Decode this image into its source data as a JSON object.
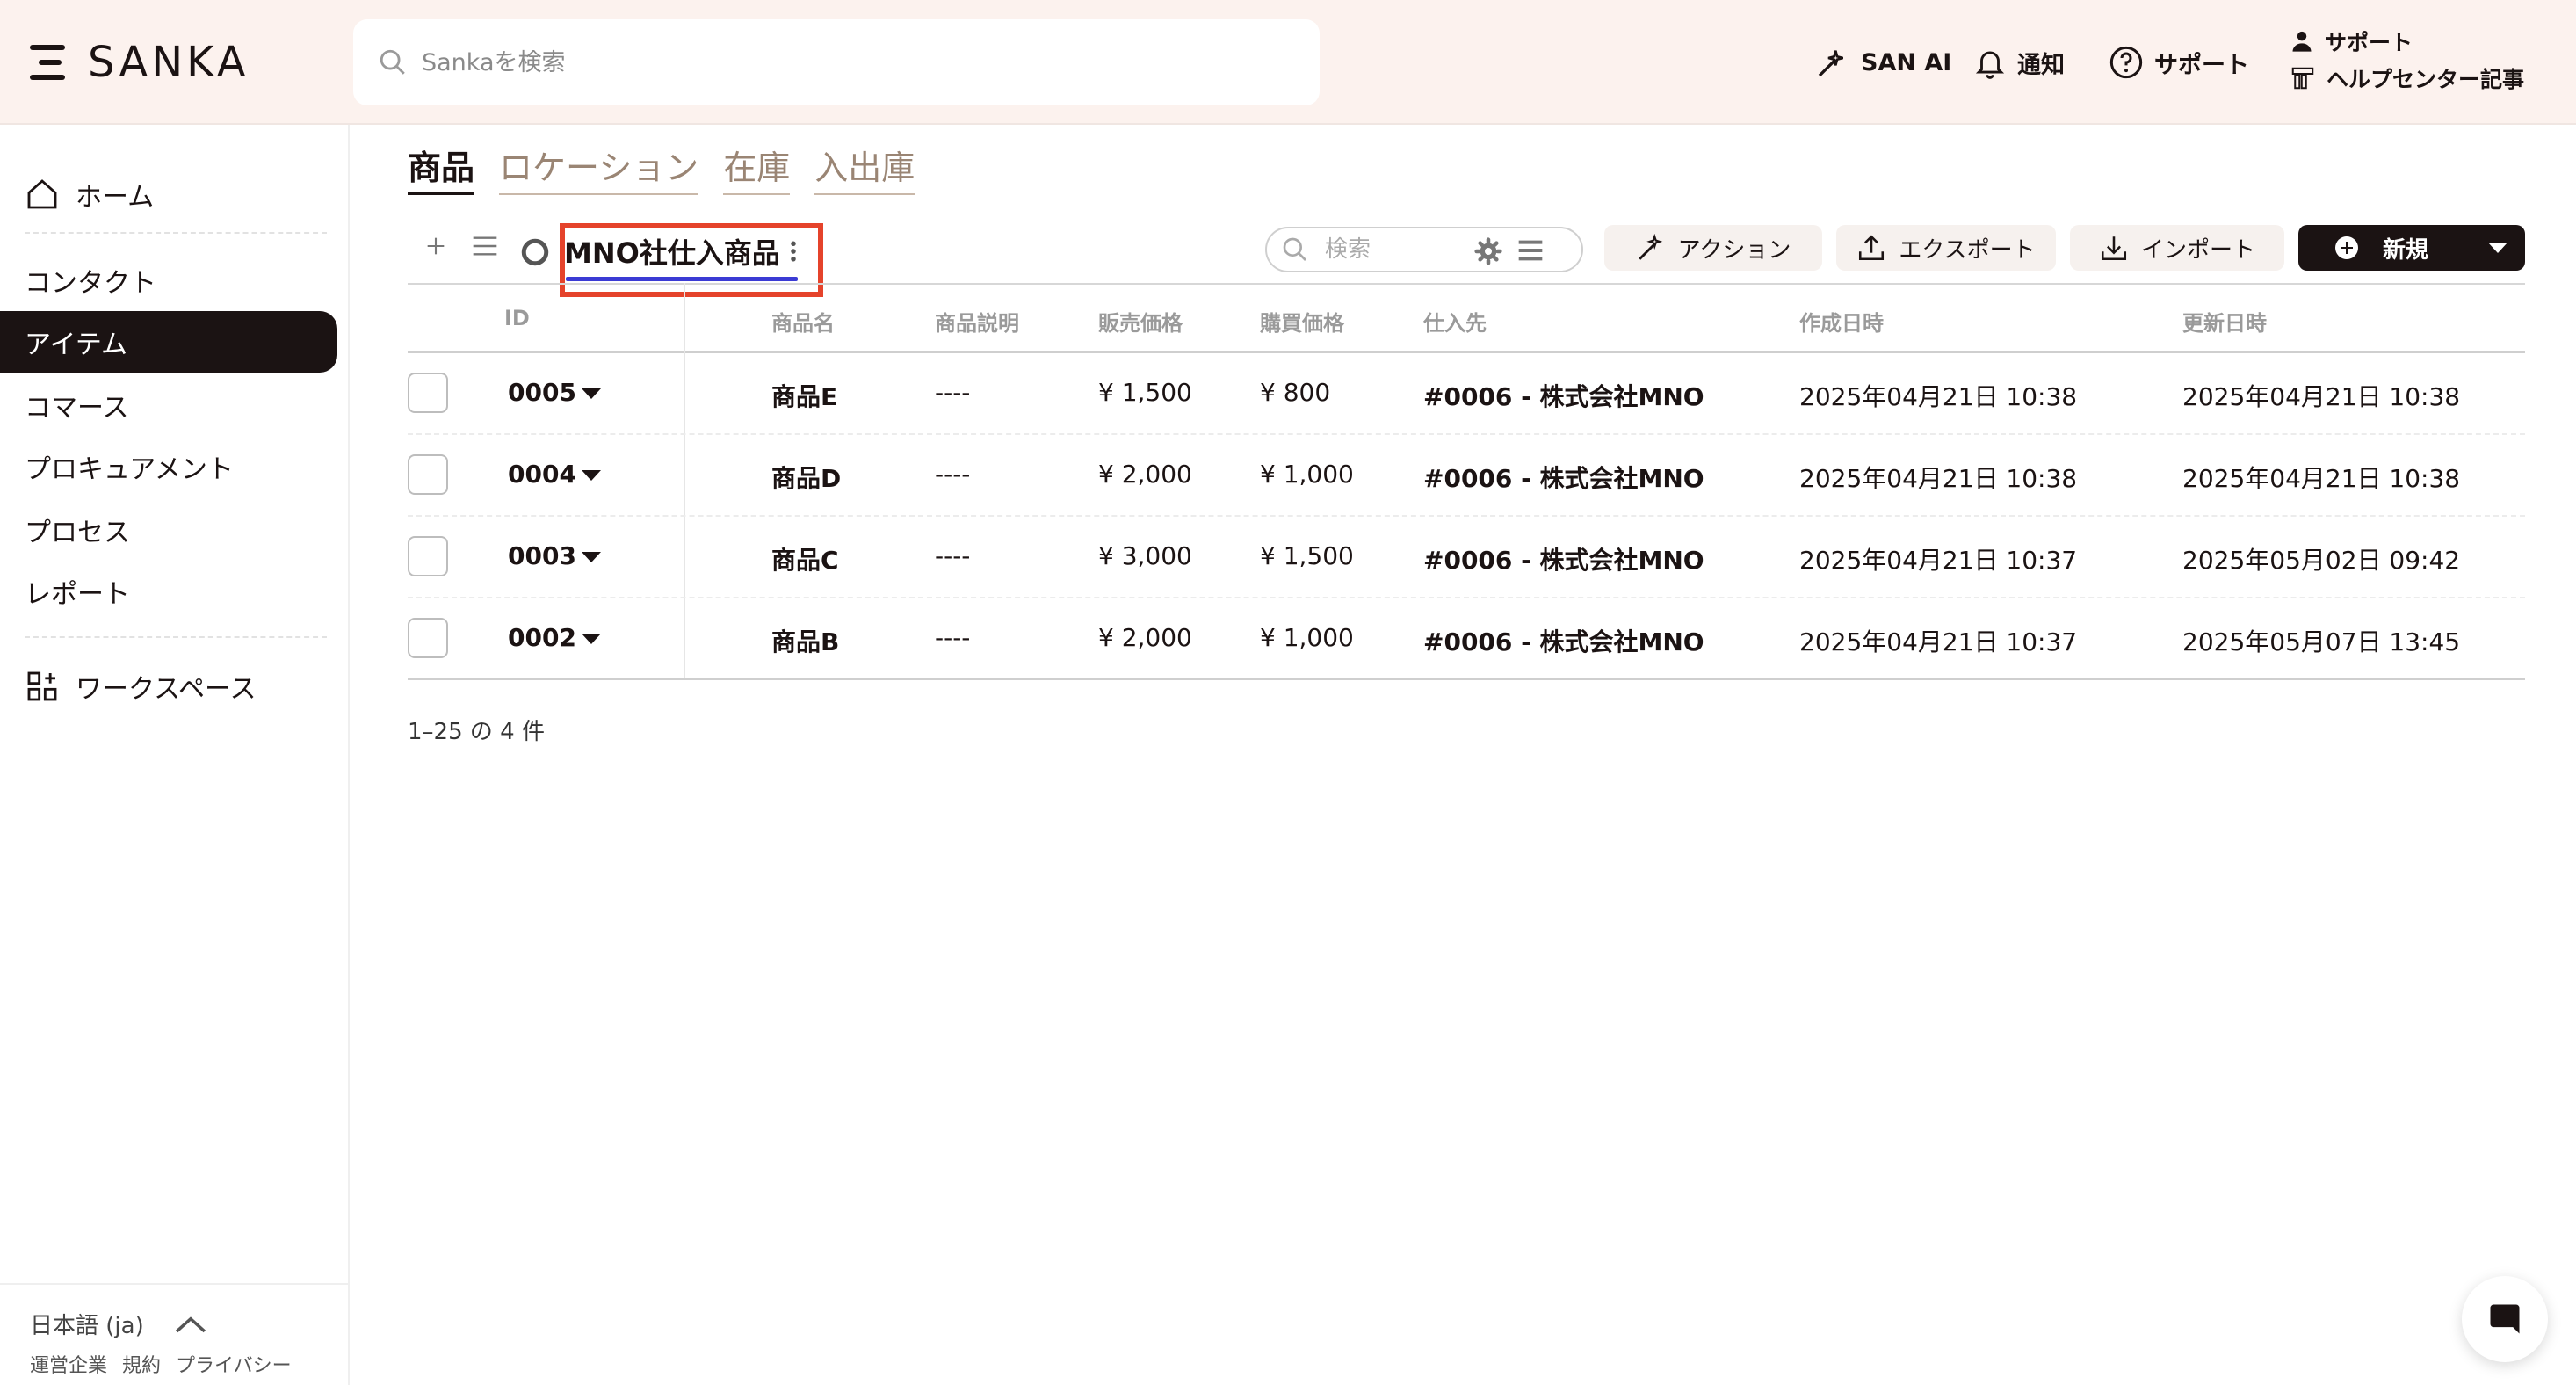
{
  "header": {
    "logo_text": "SANKA",
    "search_placeholder": "Sankaを検索",
    "san_ai": "SAN AI",
    "notifications": "通知",
    "support": "サポート",
    "support_stack": {
      "top": "サポート",
      "bottom": "ヘルプセンター記事"
    }
  },
  "sidebar": {
    "items": [
      {
        "label": "ホーム",
        "icon": "home-icon"
      },
      {
        "label": "コンタクト"
      },
      {
        "label": "アイテム",
        "active": true
      },
      {
        "label": "コマース"
      },
      {
        "label": "プロキュアメント"
      },
      {
        "label": "プロセス"
      },
      {
        "label": "レポート"
      },
      {
        "label": "ワークスペース",
        "icon": "workspace-icon"
      }
    ],
    "language": "日本語 (ja)",
    "legal": [
      "運営企業",
      "規約",
      "プライバシー"
    ]
  },
  "main": {
    "tabs": [
      {
        "label": "商品",
        "active": true
      },
      {
        "label": "ロケーション"
      },
      {
        "label": "在庫"
      },
      {
        "label": "入出庫"
      }
    ],
    "view_tab": "MNO社仕入商品",
    "toolbar": {
      "search_placeholder": "検索",
      "action": "アクション",
      "export": "エクスポート",
      "import": "インポート",
      "new": "新規"
    },
    "table": {
      "columns": [
        "ID",
        "商品名",
        "商品説明",
        "販売価格",
        "購買価格",
        "仕入先",
        "作成日時",
        "更新日時"
      ],
      "rows": [
        {
          "id": "0005",
          "name": "商品E",
          "desc": "----",
          "sale": "¥ 1,500",
          "purchase": "¥ 800",
          "supplier": "#0006 - 株式会社MNO",
          "created": "2025年04月21日 10:38",
          "updated": "2025年04月21日 10:38"
        },
        {
          "id": "0004",
          "name": "商品D",
          "desc": "----",
          "sale": "¥ 2,000",
          "purchase": "¥ 1,000",
          "supplier": "#0006 - 株式会社MNO",
          "created": "2025年04月21日 10:38",
          "updated": "2025年04月21日 10:38"
        },
        {
          "id": "0003",
          "name": "商品C",
          "desc": "----",
          "sale": "¥ 3,000",
          "purchase": "¥ 1,500",
          "supplier": "#0006 - 株式会社MNO",
          "created": "2025年04月21日 10:37",
          "updated": "2025年05月02日 09:42"
        },
        {
          "id": "0002",
          "name": "商品B",
          "desc": "----",
          "sale": "¥ 2,000",
          "purchase": "¥ 1,000",
          "supplier": "#0006 - 株式会社MNO",
          "created": "2025年04月21日 10:37",
          "updated": "2025年05月07日 13:45"
        }
      ]
    },
    "pager": "1–25 の 4 件"
  },
  "colors": {
    "header_bg": "#fcf2ee",
    "primary": "#1b1313",
    "highlight": "#e5432b",
    "tab_underline": "#3b3bd4"
  }
}
